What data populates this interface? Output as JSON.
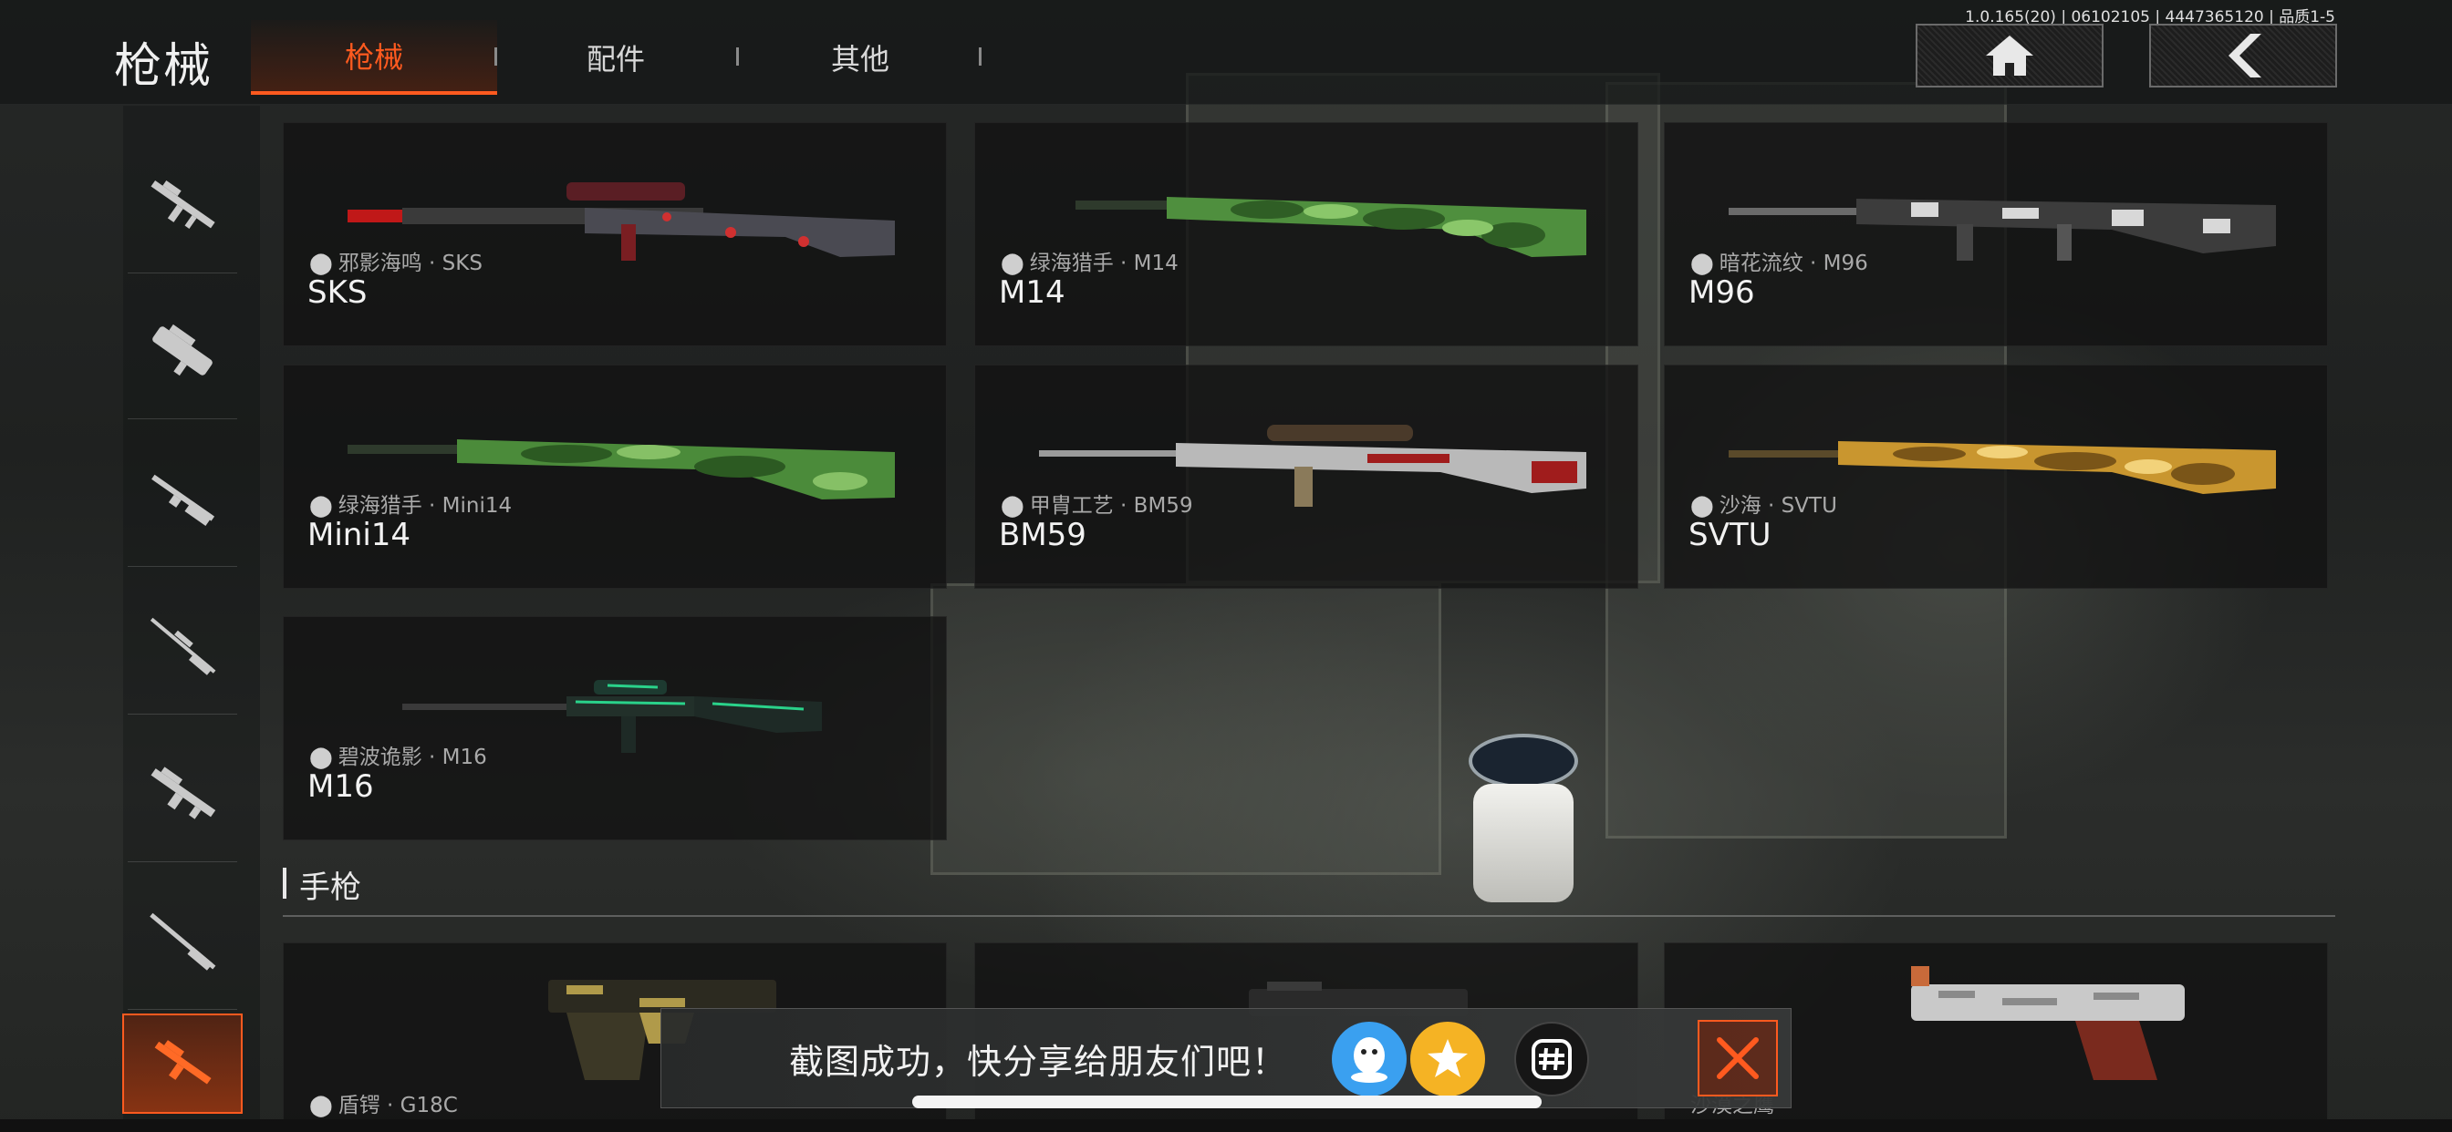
{
  "header": {
    "title": "枪械",
    "tabs": [
      {
        "label": "枪械",
        "active": true
      },
      {
        "label": "配件",
        "active": false
      },
      {
        "label": "其他",
        "active": false
      }
    ],
    "version": "1.0.165(20) | 06102105 | 4447365120 | 品质1-5",
    "home_icon": "home-icon",
    "back_icon": "back-arrow-icon"
  },
  "sidebar": {
    "items": [
      {
        "icon": "assault-rifle-icon",
        "active": false
      },
      {
        "icon": "smg-icon",
        "active": false
      },
      {
        "icon": "shotgun-icon",
        "active": false
      },
      {
        "icon": "sniper-rifle-icon",
        "active": false
      },
      {
        "icon": "light-machine-gun-icon",
        "active": false
      },
      {
        "icon": "marksman-rifle-icon",
        "active": false
      },
      {
        "icon": "pistol-category-icon",
        "active": true
      }
    ]
  },
  "cards": [
    {
      "skin": "邪影海鸣 · SKS",
      "name": "SKS"
    },
    {
      "skin": "绿海猎手 · M14",
      "name": "M14"
    },
    {
      "skin": "暗花流纹 · M96",
      "name": "M96"
    },
    {
      "skin": "绿海猎手 · Mini14",
      "name": "Mini14"
    },
    {
      "skin": "甲胄工艺 · BM59",
      "name": "BM59"
    },
    {
      "skin": "沙海 · SVTU",
      "name": "SVTU"
    },
    {
      "skin": "碧波诡影 · M16",
      "name": "M16"
    }
  ],
  "section": {
    "title": "手枪"
  },
  "pistol_cards": [
    {
      "skin": "盾锷 · G18C"
    },
    {
      "skin": ""
    },
    {
      "skin": "沙漠之鹰"
    }
  ],
  "toast": {
    "text": "截图成功，快分享给朋友们吧！",
    "share_icons": [
      "qq-icon",
      "qzone-star-icon",
      "wechat-moments-icon"
    ],
    "close_icon": "close-icon"
  },
  "colors": {
    "accent": "#ff5a1f",
    "qq": "#3aa0f0",
    "qzone": "#f5b324"
  }
}
